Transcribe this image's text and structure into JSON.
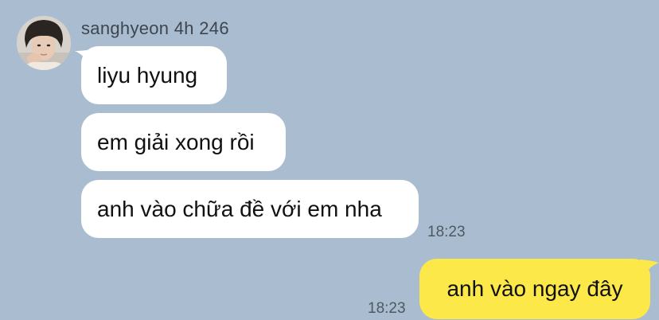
{
  "conversation": {
    "sender": {
      "name_line": "sanghyeon 4h 246"
    },
    "incoming_messages": [
      {
        "text": "liyu hyung"
      },
      {
        "text": "em giải xong rồi"
      },
      {
        "text": "anh vào chữa đề với em nha"
      }
    ],
    "incoming_time": "18:23",
    "outgoing_messages": [
      {
        "text": "anh vào ngay đây"
      }
    ],
    "outgoing_time": "18:23"
  },
  "colors": {
    "background": "#aabdd0",
    "incoming_bubble": "#ffffff",
    "outgoing_bubble": "#fde84a"
  },
  "icons": {
    "avatar": "profile-photo"
  }
}
